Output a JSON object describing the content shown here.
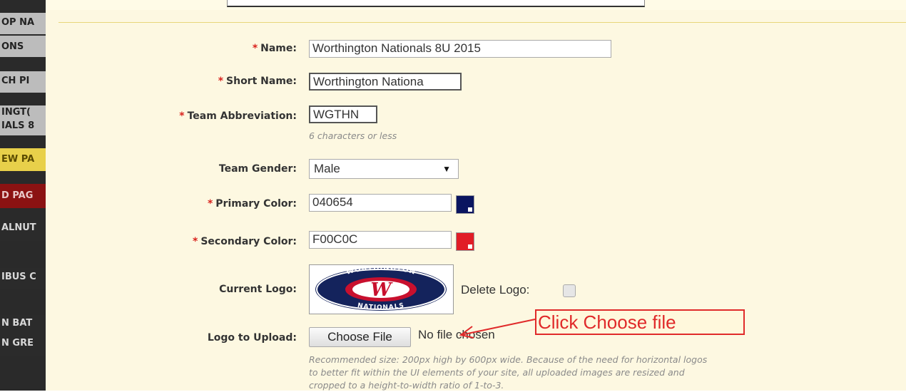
{
  "sidebar": {
    "items": [
      {
        "label": "OP NA"
      },
      {
        "label": "ONS"
      },
      {
        "label": "CH PI"
      },
      {
        "label": "INGT(",
        "label2": "IALS 8"
      },
      {
        "label": "EW PA"
      },
      {
        "label": "D PAG"
      },
      {
        "label": "ALNUT"
      },
      {
        "label": "IBUS C"
      },
      {
        "label": "N BAT"
      },
      {
        "label": "N GRE"
      }
    ]
  },
  "form": {
    "name_label": "Name:",
    "name_value": "Worthington Nationals 8U 2015",
    "short_name_label": "Short Name:",
    "short_name_value": "Worthington Nationa",
    "abbr_label": "Team Abbreviation:",
    "abbr_value": "WGTHN",
    "abbr_hint": "6 characters or less",
    "gender_label": "Team Gender:",
    "gender_value": "Male",
    "primary_color_label": "Primary Color:",
    "primary_color_value": "040654",
    "secondary_color_label": "Secondary Color:",
    "secondary_color_value": "F00C0C",
    "current_logo_label": "Current Logo:",
    "delete_logo_label": "Delete Logo:",
    "logo_upload_label": "Logo to Upload:",
    "choose_file_label": "Choose File",
    "no_file_text": "No file chosen",
    "upload_hint_line1": "Recommended size: 200px high by 600px wide. Because of the need for horizontal logos",
    "upload_hint_line2": "to better fit within the UI elements of your site, all uploaded images are resized and",
    "upload_hint_line3": "cropped to a height-to-width ratio of 1-to-3."
  },
  "logo": {
    "top_text": "WORTHINGTON",
    "bottom_text": "NATIONALS",
    "mark": "W"
  },
  "annotation": {
    "callout_text": "Click Choose file"
  },
  "colors": {
    "primary_swatch": "#0a1560",
    "secondary_swatch": "#e11d26",
    "required_star": "#d9231d",
    "callout": "#e02a2a"
  }
}
